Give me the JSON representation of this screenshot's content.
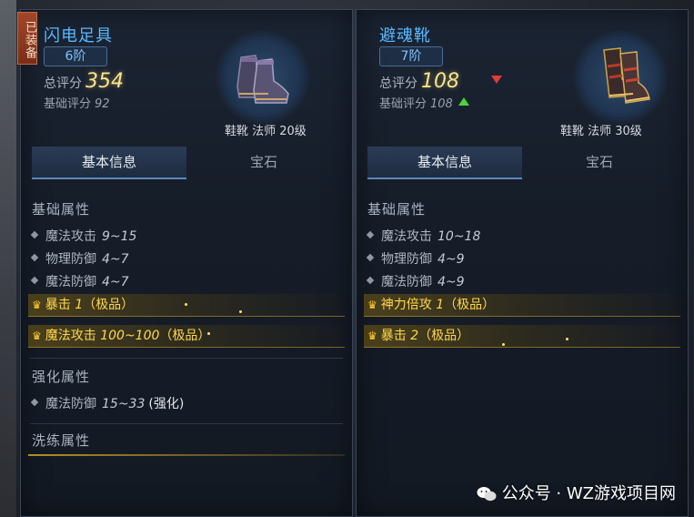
{
  "left": {
    "equipped_badge": "已装备",
    "name": "闪电足具",
    "grade": "6阶",
    "total_score_label": "总评分",
    "total_score": "354",
    "base_score_label": "基础评分",
    "base_score": "92",
    "item_desc": "鞋靴 法师 20级",
    "tabs": [
      "基本信息",
      "宝石"
    ],
    "base_attrs_title": "基础属性",
    "base_attrs": [
      {
        "name": "魔法攻击",
        "value": "9~15"
      },
      {
        "name": "物理防御",
        "value": "4~7"
      },
      {
        "name": "魔法防御",
        "value": "4~7"
      }
    ],
    "special_attrs": [
      {
        "text": "暴击 ",
        "value": "1",
        "suffix": "（极品）"
      },
      {
        "text": "魔法攻击 ",
        "value": "100~100",
        "suffix": "（极品）"
      }
    ],
    "enhance_title": "强化属性",
    "enhance_attrs": [
      {
        "name": "魔法防御",
        "value": "15~33",
        "tag": "(强化)"
      }
    ],
    "refine_title": "洗练属性"
  },
  "right": {
    "name": "避魂靴",
    "grade": "7阶",
    "total_score_label": "总评分",
    "total_score": "108",
    "base_score_label": "基础评分",
    "base_score": "108",
    "item_desc": "鞋靴 法师 30级",
    "tabs": [
      "基本信息",
      "宝石"
    ],
    "base_attrs_title": "基础属性",
    "base_attrs": [
      {
        "name": "魔法攻击",
        "value": "10~18"
      },
      {
        "name": "物理防御",
        "value": "4~9"
      },
      {
        "name": "魔法防御",
        "value": "4~9"
      }
    ],
    "special_attrs": [
      {
        "text": "神力倍攻 ",
        "value": "1",
        "suffix": "（极品）"
      },
      {
        "text": "暴击 ",
        "value": "2",
        "suffix": "（极品）"
      }
    ]
  },
  "watermark": "公众号 · WZ游戏项目网",
  "colors": {
    "accent": "#59b8ff",
    "gold": "#ffd84a",
    "down": "#e23b3b",
    "up": "#4cd43a"
  }
}
